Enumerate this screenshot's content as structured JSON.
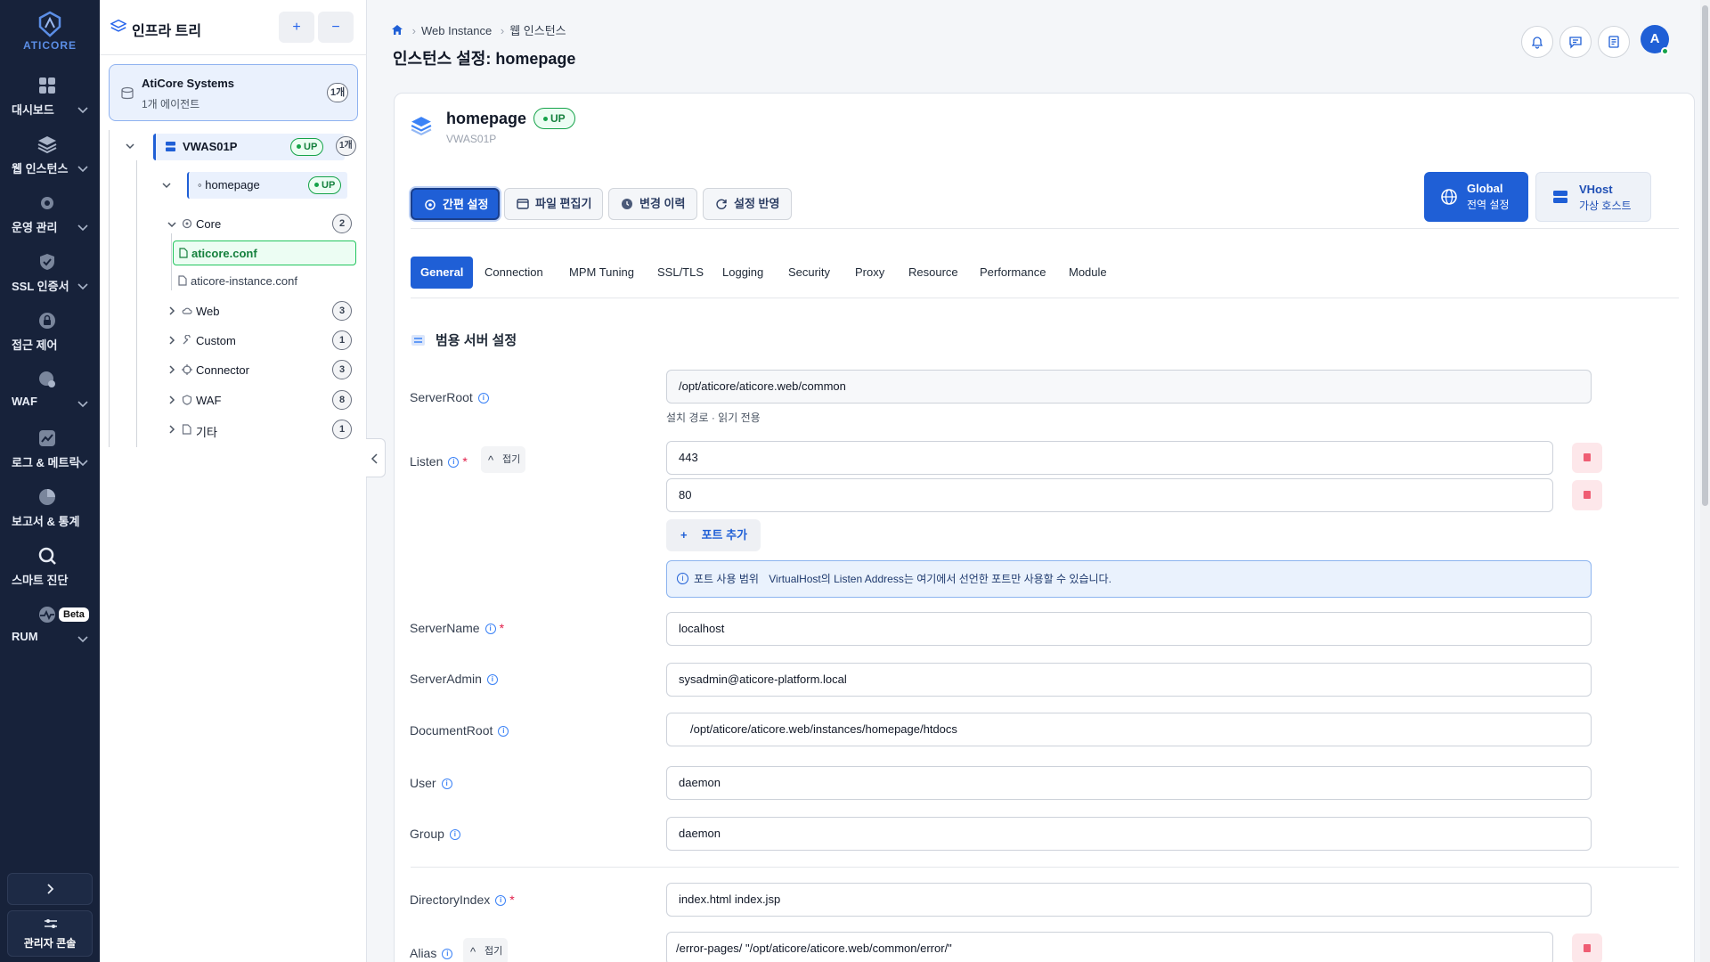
{
  "nav": {
    "brand": "ATICORE",
    "items": [
      {
        "label": "대시보드",
        "icon": "dashboard-icon"
      },
      {
        "label": "웹 인스턴스",
        "icon": "layers-icon"
      },
      {
        "label": "운영 관리",
        "icon": "gear-icon"
      },
      {
        "label": "SSL 인증서",
        "icon": "shield-check-icon"
      },
      {
        "label": "접근 제어",
        "icon": "lock-icon"
      },
      {
        "label": "WAF",
        "icon": "shield-icon"
      },
      {
        "label": "로그 & 메트릭",
        "icon": "metrics-icon"
      },
      {
        "label": "보고서 & 통계",
        "icon": "pie-chart-icon"
      },
      {
        "label": "스마트 진단",
        "icon": "search-icon"
      },
      {
        "label": "RUM",
        "icon": "pulse-icon",
        "badge": "Beta"
      }
    ],
    "admin_label": "관리자 콘솔"
  },
  "tree": {
    "title": "인프라 트리",
    "add": "+",
    "remove": "−",
    "org": {
      "name": "AtiCore Systems",
      "agents": "1개 에이전트",
      "count": "1개"
    },
    "server": {
      "name": "VWAS01P",
      "status": "UP",
      "count": "1개"
    },
    "instance": {
      "name": "homepage",
      "status": "UP"
    },
    "groups": [
      {
        "name": "Core",
        "count": "2"
      },
      {
        "name": "Web",
        "count": "3"
      },
      {
        "name": "Custom",
        "count": "1"
      },
      {
        "name": "Connector",
        "count": "3"
      },
      {
        "name": "WAF",
        "count": "8"
      },
      {
        "name": "기타",
        "count": "1"
      }
    ],
    "files": [
      "aticore.conf",
      "aticore-instance.conf"
    ]
  },
  "header": {
    "breadcrumb": [
      "Web Instance",
      "웹 인스턴스"
    ],
    "title": "인스턴스 설정: homepage",
    "avatar": "A"
  },
  "instance": {
    "name": "homepage",
    "status": "UP",
    "server": "VWAS01P"
  },
  "actions": [
    "간편 설정",
    "파일 편집기",
    "변경 이력",
    "설정 반영"
  ],
  "scope": {
    "global": {
      "title": "Global",
      "sub": "전역 설정"
    },
    "vhost": {
      "title": "VHost",
      "sub": "가상 호스트"
    }
  },
  "tabs": [
    "General",
    "Connection",
    "MPM Tuning",
    "SSL/TLS",
    "Logging",
    "Security",
    "Proxy",
    "Resource",
    "Performance",
    "Module"
  ],
  "section_title": "범용 서버 설정",
  "fold_label": "접기",
  "fields": {
    "serverroot": {
      "label": "ServerRoot",
      "value": "/opt/aticore/aticore.web/common",
      "hint": "설치 경로 · 읽기 전용"
    },
    "listen": {
      "label": "Listen",
      "values": [
        "443",
        "80"
      ],
      "add_label": "포트 추가",
      "notice_title": "포트 사용 범위",
      "notice": "VirtualHost의 Listen Address는 여기에서 선언한 포트만 사용할 수 있습니다."
    },
    "servername": {
      "label": "ServerName",
      "value": "localhost"
    },
    "serveradmin": {
      "label": "ServerAdmin",
      "value": "sysadmin@aticore-platform.local"
    },
    "documentroot": {
      "label": "DocumentRoot",
      "value": "/opt/aticore/aticore.web/instances/homepage/htdocs"
    },
    "user": {
      "label": "User",
      "value": "daemon"
    },
    "group": {
      "label": "Group",
      "value": "daemon"
    },
    "directoryindex": {
      "label": "DirectoryIndex",
      "value": "index.html index.jsp"
    },
    "alias": {
      "label": "Alias",
      "value": "/error-pages/ \"/opt/aticore/aticore.web/common/error/\""
    }
  }
}
